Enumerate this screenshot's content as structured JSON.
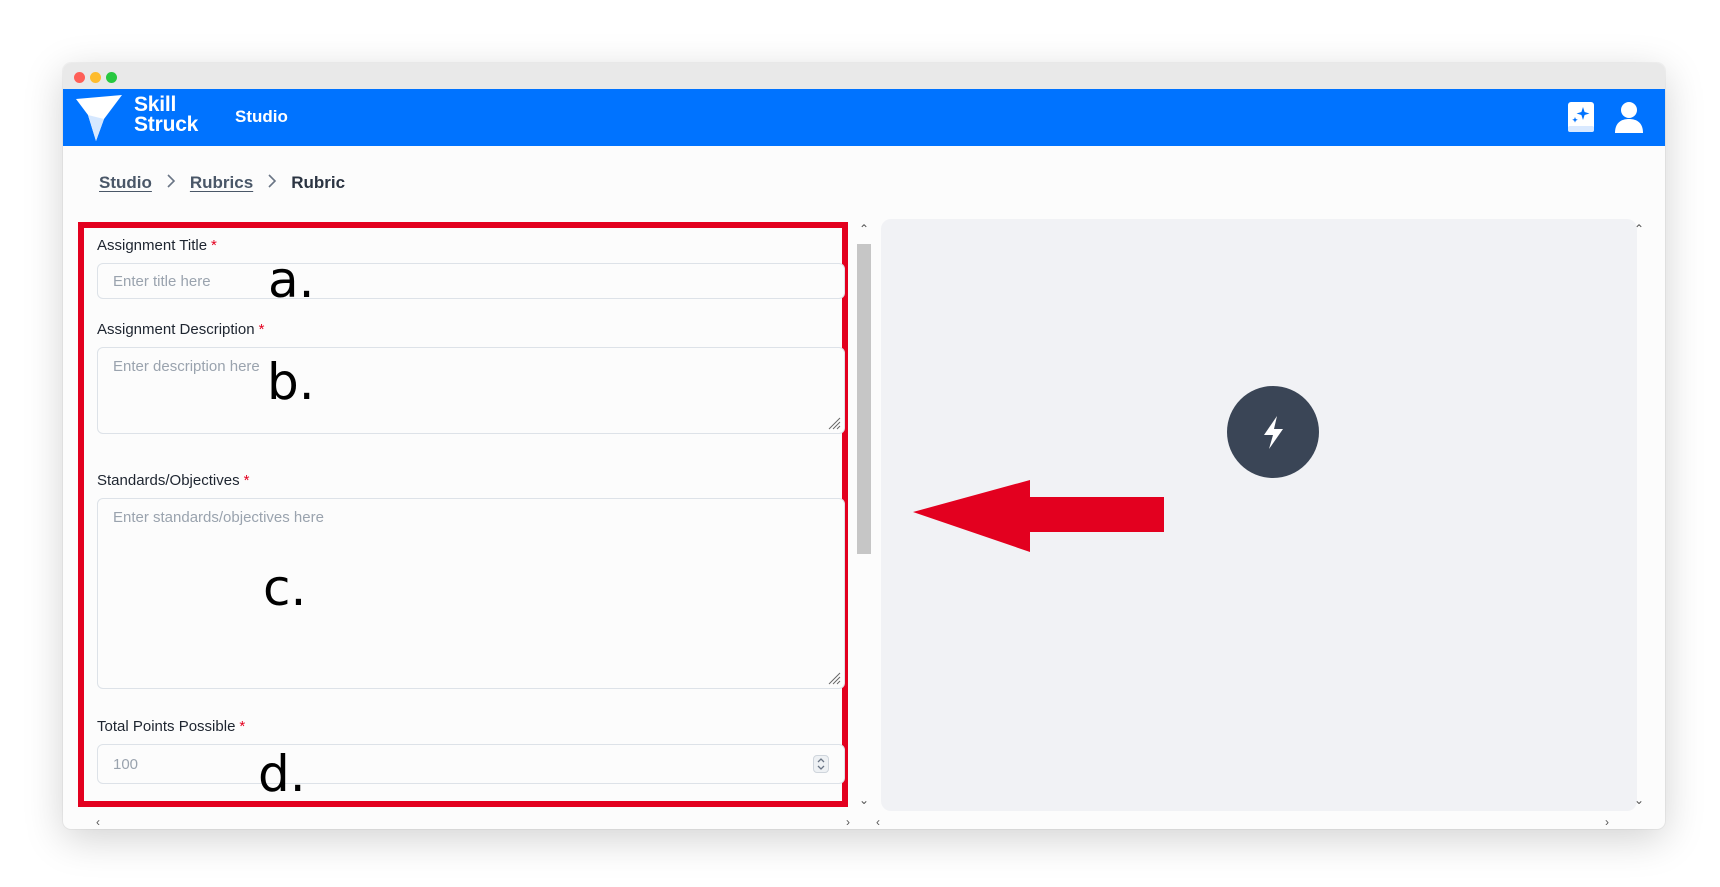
{
  "app": {
    "brand_line1": "Skill",
    "brand_line2": "Struck",
    "app_name": "Studio"
  },
  "breadcrumb": {
    "items": [
      "Studio",
      "Rubrics"
    ],
    "separator": ">",
    "current": "Rubric"
  },
  "form": {
    "title": {
      "label": "Assignment Title",
      "required": "*",
      "placeholder": "Enter title here"
    },
    "description": {
      "label": "Assignment Description",
      "required": "*",
      "placeholder": "Enter description here"
    },
    "standards": {
      "label": "Standards/Objectives",
      "required": "*",
      "placeholder": "Enter standards/objectives here"
    },
    "points": {
      "label": "Total Points Possible",
      "required": "*",
      "placeholder": "100"
    }
  },
  "annotations": [
    "a.",
    "b.",
    "c.",
    "d."
  ],
  "icons": {
    "logo": "skill-struck-logo",
    "book": "magic-book-icon",
    "user": "user-icon",
    "bolt": "lightning-bolt-icon"
  },
  "colors": {
    "appbar": "#0073ff",
    "highlight": "#e3001f",
    "bolt_button": "#3a4556"
  }
}
